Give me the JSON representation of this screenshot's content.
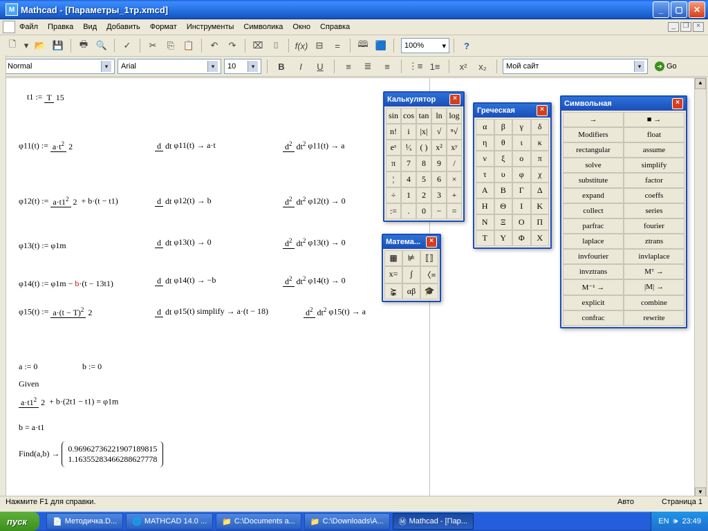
{
  "window": {
    "title": "Mathcad - [Параметры_1тр.xmcd]"
  },
  "menu": [
    "Файл",
    "Правка",
    "Вид",
    "Добавить",
    "Формат",
    "Инструменты",
    "Символика",
    "Окно",
    "Справка"
  ],
  "toolbar": {
    "zoom": "100%"
  },
  "format": {
    "style": "Normal",
    "font": "Arial",
    "size": "10",
    "site": "Мой сайт",
    "go": "Go"
  },
  "palettes": {
    "calc": {
      "title": "Калькулятор",
      "items": [
        "sin",
        "cos",
        "tan",
        "ln",
        "log",
        "n!",
        "i",
        "|x|",
        "√",
        "ⁿ√",
        "eˣ",
        "¹⁄ₓ",
        "( )",
        "x²",
        "xʸ",
        "π",
        "7",
        "8",
        "9",
        "/",
        "¦",
        "4",
        "5",
        "6",
        "×",
        "÷",
        "1",
        "2",
        "3",
        "+",
        ":=",
        ".",
        "0",
        "−",
        "="
      ]
    },
    "greek": {
      "title": "Греческая",
      "lower": [
        "α",
        "β",
        "γ",
        "δ",
        "η",
        "θ",
        "ι",
        "κ",
        "ν",
        "ξ",
        "ο",
        "π",
        "τ",
        "υ",
        "φ",
        "χ"
      ],
      "upper": [
        "Α",
        "Β",
        "Γ",
        "Δ",
        "Η",
        "Θ",
        "Ι",
        "Κ",
        "Ν",
        "Ξ",
        "Ο",
        "Π",
        "Τ",
        "Υ",
        "Φ",
        "Χ"
      ]
    },
    "math": {
      "title": "Матема...",
      "icons": [
        "▦",
        "⊭",
        "⟦⟧",
        "x=",
        "∫",
        "〈≡",
        "⪺",
        "αβ",
        "🎓"
      ]
    },
    "sym": {
      "title": "Символьная",
      "items": [
        "→",
        "■ →",
        "Modifiers",
        "float",
        "rectangular",
        "assume",
        "solve",
        "simplify",
        "substitute",
        "factor",
        "expand",
        "coeffs",
        "collect",
        "series",
        "parfrac",
        "fourier",
        "laplace",
        "ztrans",
        "invfourier",
        "invlaplace",
        "invztrans",
        "Mᵀ →",
        "M⁻¹ →",
        "|M| →",
        "explicit",
        "combine",
        "confrac",
        "rewrite"
      ]
    }
  },
  "equations": {
    "def_t1": "t1 := ",
    "def_a0": "a := 0",
    "def_b0": "b := 0",
    "given": "Given",
    "b_eq": "b = a·t1",
    "find": "Find(a,b) →",
    "r1": "0.96962736221907189815",
    "r2": "1.16355283466288627778",
    "phi11": "φ11(t) := ",
    "d_phi11": "φ11(t) → a·t",
    "d2_phi11": "φ11(t) → a",
    "phi12": "φ12(t) := ",
    "phi12r": " + b·(t − t1)",
    "d_phi12": "φ12(t) → b",
    "d2_phi12": "φ12(t) → 0",
    "phi13": "φ13(t) := φ1m",
    "d_phi13": "φ13(t) → 0",
    "d2_phi13": "φ13(t) → 0",
    "phi14": "φ14(t) := φ1m − ",
    "phi14r": "·(t − 13t1)",
    "d_phi14": "φ14(t) → −b",
    "d2_phi14": "φ14(t) → 0",
    "phi15": "φ15(t) := ",
    "d_phi15": "φ15(t) simplify → a·(t − 18)",
    "d2_phi15": "φ15(t) → a",
    "block": " + b·(2t1 − t1) = φ1m"
  },
  "status": {
    "help": "Нажмите F1 для справки.",
    "auto": "Авто",
    "page": "Страница 1"
  },
  "taskbar": {
    "start": "пуск",
    "items": [
      "Методичка.D...",
      "MATHCAD 14.0 ...",
      "C:\\Documents a...",
      "C:\\Downloads\\A...",
      "Mathcad - [Пар..."
    ],
    "lang": "EN",
    "time": "23:49"
  }
}
